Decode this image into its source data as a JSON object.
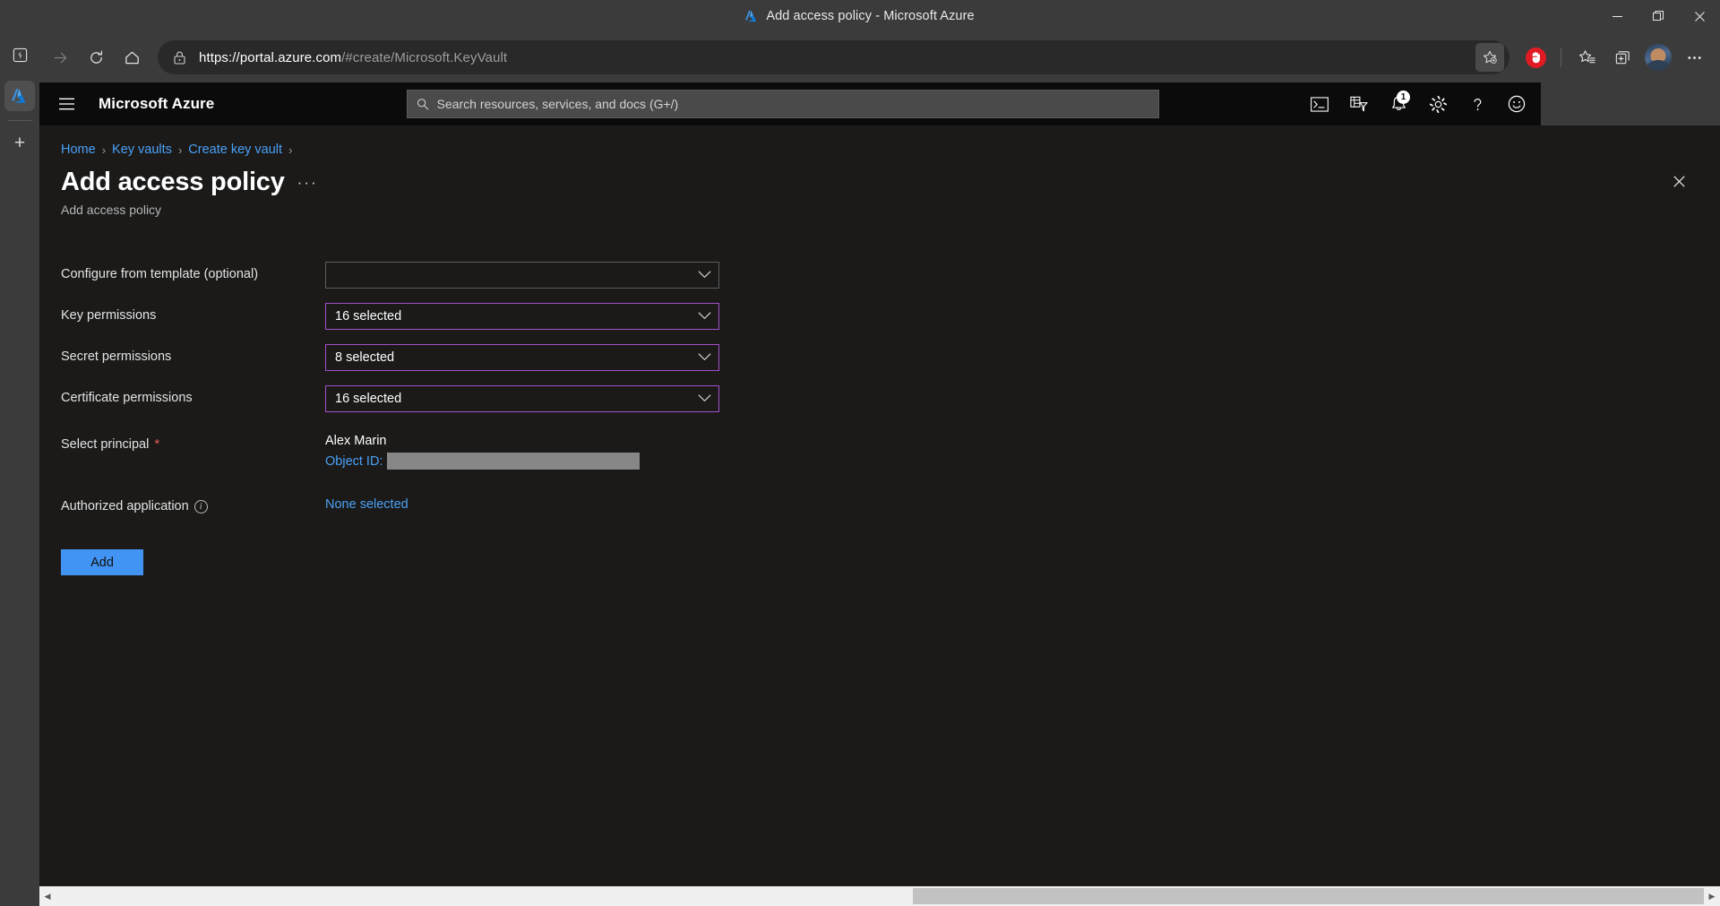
{
  "window": {
    "title": "Add access policy - Microsoft Azure",
    "controls": {
      "minimize": "Minimize",
      "restore": "Restore",
      "close": "Close"
    }
  },
  "browser": {
    "nav": {
      "back": "Back",
      "forward": "Forward",
      "refresh": "Refresh",
      "home": "Home"
    },
    "url": {
      "host": "https://portal.azure.com",
      "path": "/#create/Microsoft.KeyVault"
    },
    "toolbar_icons": [
      "add-favorite-icon",
      "extension-adblock-icon",
      "favorites-icon",
      "collections-icon",
      "profile-avatar",
      "settings-more-icon"
    ],
    "vertical_tabs": {
      "tab_actions": "tab-actions-icon",
      "active_tab": "Add access policy - Microsoft Azure",
      "new_tab": "+"
    }
  },
  "portal": {
    "brand": "Microsoft Azure",
    "menu_label": "Show portal menu",
    "search": {
      "placeholder": "Search resources, services, and docs (G+/)",
      "value": ""
    },
    "header_actions": [
      {
        "name": "cloud-shell-icon",
        "label": "Cloud Shell"
      },
      {
        "name": "directories-subscriptions-icon",
        "label": "Directories + subscriptions"
      },
      {
        "name": "notifications-bell-icon",
        "label": "Notifications",
        "badge": "1"
      },
      {
        "name": "settings-gear-icon",
        "label": "Settings"
      },
      {
        "name": "help-question-icon",
        "label": "Help"
      },
      {
        "name": "feedback-smiley-icon",
        "label": "Feedback"
      }
    ]
  },
  "blade": {
    "breadcrumb": [
      "Home",
      "Key vaults",
      "Create key vault"
    ],
    "breadcrumb_separator": "›",
    "title": "Add access policy",
    "more_menu": "···",
    "subtitle": "Add access policy",
    "close_label": "Close"
  },
  "form": {
    "template": {
      "label": "Configure from template (optional)",
      "value": "",
      "touched": false
    },
    "key_permissions": {
      "label": "Key permissions",
      "value": "16 selected",
      "touched": true
    },
    "secret_permissions": {
      "label": "Secret permissions",
      "value": "8 selected",
      "touched": true
    },
    "certificate_permissions": {
      "label": "Certificate permissions",
      "value": "16 selected",
      "touched": true
    },
    "select_principal": {
      "label": "Select principal",
      "required_marker": "*",
      "principal_name": "Alex Marin",
      "object_id_label": "Object ID:",
      "object_id_value": ""
    },
    "authorized_application": {
      "label": "Authorized application",
      "info_marker": "i",
      "value": "None selected"
    },
    "submit": {
      "label": "Add"
    }
  },
  "colors": {
    "azure_blue": "#4294f4",
    "link_blue": "#4aa0f5",
    "touched_border": "#a44fc9",
    "required_red": "#e05c5c",
    "portal_bg": "#1b1a19",
    "header_bg": "#0b0b0b",
    "chrome_bg": "#3b3b3b"
  },
  "scrollbar": {
    "left_arrow": "◀",
    "right_arrow": "▶"
  }
}
